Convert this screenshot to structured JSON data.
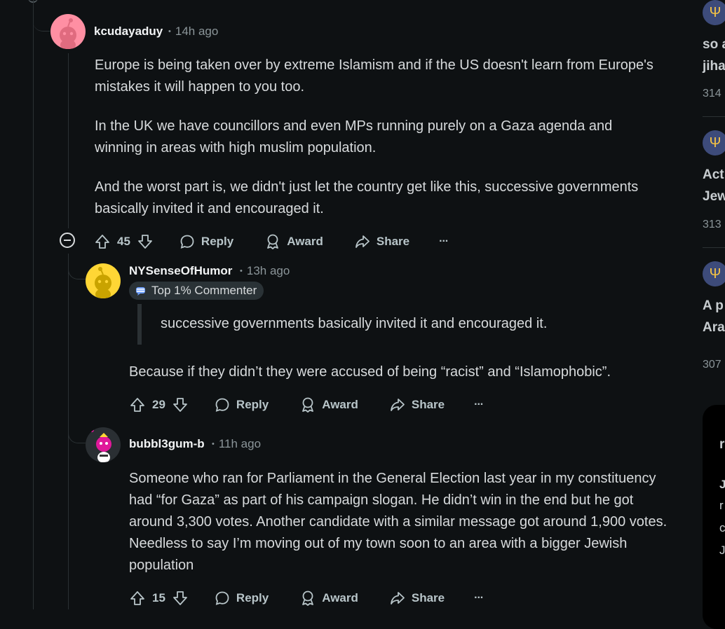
{
  "comments": [
    {
      "username": "kcudayaduy",
      "time": "14h ago",
      "paragraphs": [
        "Europe is being taken over by extreme Islamism and if the US doesn't learn from Europe's mistakes it will happen to you too.",
        "In the UK we have councillors and even MPs running purely on a Gaza agenda and winning in areas with high muslim population.",
        "And the worst part is, we didn't just let the country get like this, successive governments basically invited it and encouraged it."
      ],
      "votes": "45"
    },
    {
      "username": "NYSenseOfHumor",
      "time": "13h ago",
      "badge": "Top 1% Commenter",
      "quote": "successive governments basically invited it and encouraged it.",
      "text": "Because if they didn’t they were accused of being “racist” and “Islamophobic”.",
      "votes": "29"
    },
    {
      "username": "bubbl3gum-b",
      "time": "11h ago",
      "text": "Someone who ran for Parliament in the General Election last year in my constituency had “for Gaza” as part of his campaign slogan. He didn’t win in the end but he got around 3,300 votes. Another candidate with a similar message got around 1,900 votes. Needless to say I’m moving out of my town soon to an area with a bigger Jewish population",
      "votes": "15"
    }
  ],
  "actions": {
    "reply": "Reply",
    "award": "Award",
    "share": "Share",
    "more": "···",
    "separator": "•"
  },
  "sidebar": {
    "posts": [
      {
        "line1": "so a",
        "line2": "jiha",
        "count": "314"
      },
      {
        "line1": "Act",
        "line2": "Jew",
        "count": "313"
      },
      {
        "line1": "A p",
        "line2": "Ara",
        "count": "307"
      }
    ],
    "promo_letters": [
      "r",
      "J",
      "r",
      "c",
      "J"
    ]
  },
  "colors": {
    "background": "#0e1113",
    "text": "#d7dadc",
    "meta": "#8b9599",
    "icon_badge": "#3d4b7a"
  }
}
